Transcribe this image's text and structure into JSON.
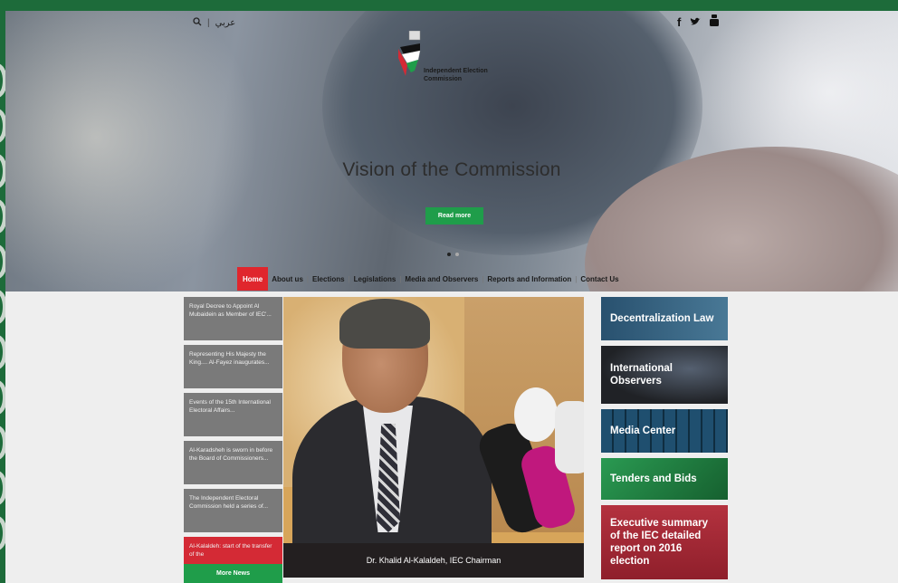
{
  "topbar": {
    "search_icon": "search-icon",
    "separator": "|",
    "language": "عربي"
  },
  "social": {
    "facebook": "f",
    "twitter": "🐦",
    "youtube": "▶"
  },
  "logo": {
    "name": "Independent Election\nCommission"
  },
  "hero": {
    "title": "Vision of the Commission",
    "button": "Read more"
  },
  "nav": {
    "items": [
      "Home",
      "About us",
      "Elections",
      "Legislations",
      "Media and Observers",
      "Reports and Information",
      "Contact Us"
    ]
  },
  "news": {
    "items": [
      "Royal Decree to Appoint Al Mubaidein as Member of IEC'...",
      "Representing His Majesty the King.... Al-Fayez inaugurates...",
      "Events of the 15th International Electoral Affairs...",
      "Al-Karadsheh is sworn in before the Board of Commissioners...",
      "The Independent Electoral Commission held a series of...",
      "Al-Kalaldeh: start of the transfer of the"
    ],
    "more": "More News"
  },
  "feature": {
    "caption": "Dr. Khalid Al-Kalaldeh, IEC Chairman"
  },
  "tiles": {
    "decentralization": "Decentralization Law",
    "observers": "International Observers",
    "media": "Media Center",
    "tenders": "Tenders and Bids",
    "summary": "Executive summary of the IEC detailed report on 2016 election"
  },
  "colors": {
    "green": "#1f9d4a",
    "red": "#e0262d",
    "frame": "#1d6b3a"
  }
}
